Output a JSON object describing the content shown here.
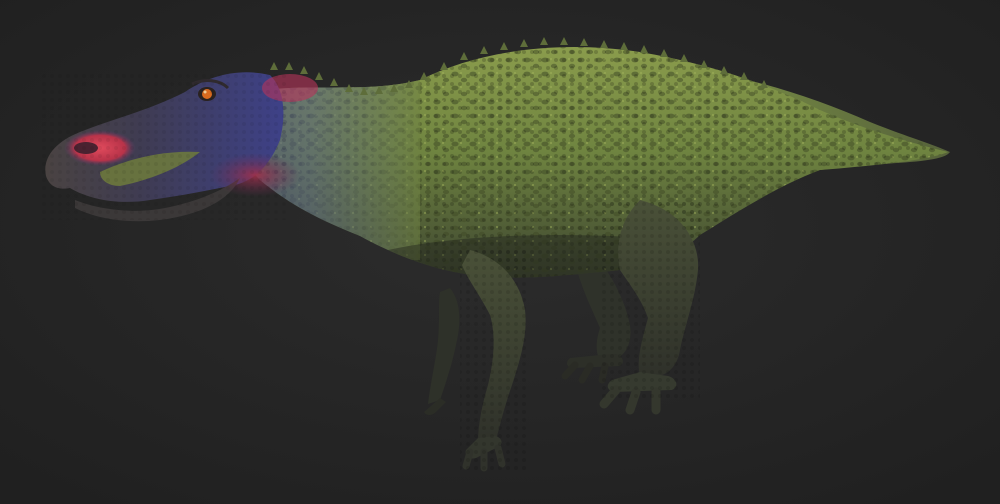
{
  "scene": {
    "subject_icon": "dinosaur-icon",
    "colors": {
      "background": "#262626",
      "body_green": "#7e9148",
      "body_green_dark": "#4b5a2c",
      "leg_dark": "#3a3d31",
      "head_blue": "#3f4487",
      "snout_gray": "#44403f",
      "nostril_red": "#c93c50",
      "eye_orange": "#d96a1e"
    }
  }
}
